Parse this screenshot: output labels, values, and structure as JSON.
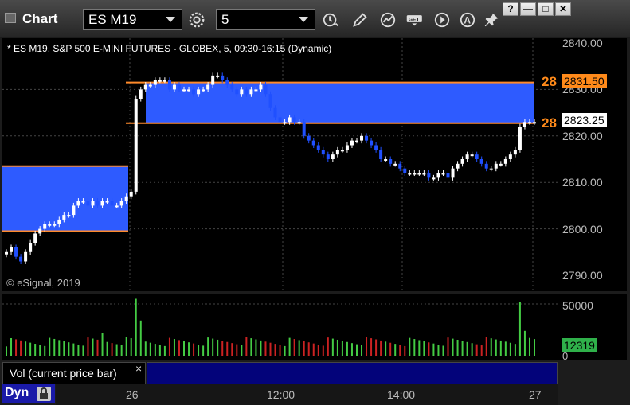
{
  "window": {
    "title": "Chart",
    "symbol": "ES M19",
    "interval": "5",
    "buttons": {
      "help": "?",
      "minimize": "—",
      "restore": "□",
      "close": "✕"
    }
  },
  "chart": {
    "description": "* ES M19, S&P 500 E-MINI FUTURES - GLOBEX, 5, 09:30-16:15 (Dynamic)",
    "watermark": "© eSignal, 2019",
    "price_axis_labels": [
      "2840.00",
      "2830.00",
      "2820.00",
      "2810.00",
      "2800.00",
      "2790.00"
    ],
    "price_markers": [
      {
        "label": "2831.50",
        "style": "orange"
      },
      {
        "label": "2823.25",
        "style": "white"
      }
    ],
    "line_labels": [
      "28",
      "28"
    ],
    "zones": [
      {
        "from_time": "prior day",
        "low": 2799.5,
        "high": 2813.5
      },
      {
        "from_time": "26",
        "low": 2822.75,
        "high": 2831.5
      }
    ]
  },
  "volume": {
    "axis_labels": [
      "50000",
      "0"
    ],
    "current_value": "12319",
    "indicator_label": "Vol (current price bar)",
    "close_glyph": "×"
  },
  "time_axis": {
    "labels": [
      "26",
      "12:00",
      "14:00",
      "27"
    ]
  },
  "status": {
    "mode": "Dyn"
  },
  "colors": {
    "zone": "#2e5bff",
    "zone_line": "#ff8a2a",
    "up_candle": "#ffffff",
    "down_candle": "#2050ff",
    "vol_up": "#44cc44",
    "vol_down": "#cc2222",
    "accent_orange": "#ff8a1a"
  }
}
